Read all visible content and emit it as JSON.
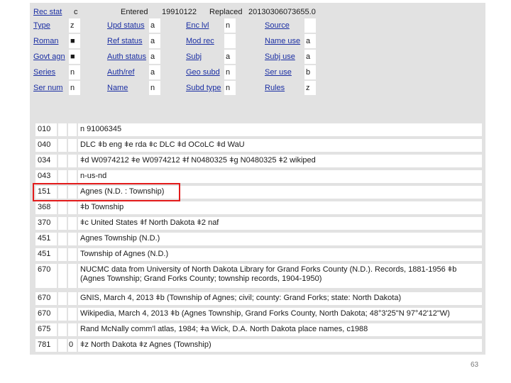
{
  "header": {
    "rec_stat_label": "Rec stat",
    "rec_stat_value": "c",
    "entered_label": "Entered",
    "entered_value": "19910122",
    "replaced_label": "Replaced",
    "replaced_value": "20130306073655.0"
  },
  "fixed_fields": [
    [
      {
        "label": "Type",
        "value": "z"
      },
      {
        "label": "Upd status",
        "value": "a"
      },
      {
        "label": "Enc lvl",
        "value": "n"
      },
      {
        "label": "Source",
        "value": ""
      }
    ],
    [
      {
        "label": "Roman",
        "value": "■"
      },
      {
        "label": "Ref status",
        "value": "a"
      },
      {
        "label": "Mod rec",
        "value": ""
      },
      {
        "label": "Name use",
        "value": "a"
      }
    ],
    [
      {
        "label": "Govt agn",
        "value": "■"
      },
      {
        "label": "Auth status",
        "value": "a"
      },
      {
        "label": "Subj",
        "value": "a"
      },
      {
        "label": "Subj use",
        "value": "a"
      }
    ],
    [
      {
        "label": "Series",
        "value": "n"
      },
      {
        "label": "Auth/ref",
        "value": "a"
      },
      {
        "label": "Geo subd",
        "value": "n"
      },
      {
        "label": "Ser use",
        "value": "b"
      }
    ],
    [
      {
        "label": "Ser num",
        "value": "n"
      },
      {
        "label": "Name",
        "value": "n"
      },
      {
        "label": "Subd type",
        "value": "n"
      },
      {
        "label": "Rules",
        "value": "z"
      }
    ]
  ],
  "fields": [
    {
      "tag": "010",
      "ind2": "",
      "value": "n 91006345"
    },
    {
      "tag": "040",
      "ind2": "",
      "value": "DLC ǂb eng ǂe rda ǂc DLC ǂd OCoLC ǂd WaU"
    },
    {
      "tag": "034",
      "ind2": "",
      "value": "ǂd W0974212 ǂe W0974212 ǂf N0480325 ǂg N0480325 ǂ2 wikiped"
    },
    {
      "tag": "043",
      "ind2": "",
      "value": "n-us-nd"
    },
    {
      "tag": "151",
      "ind2": "",
      "value": "Agnes (N.D. : Township)"
    },
    {
      "tag": "368",
      "ind2": "",
      "value": "ǂb Township"
    },
    {
      "tag": "370",
      "ind2": "",
      "value": "ǂc United States ǂf North Dakota ǂ2 naf"
    },
    {
      "tag": "451",
      "ind2": "",
      "value": "Agnes Township (N.D.)"
    },
    {
      "tag": "451",
      "ind2": "",
      "value": "Township of Agnes (N.D.)"
    },
    {
      "tag": "670",
      "ind2": "",
      "value": "NUCMC data from University of North Dakota Library for Grand Forks County (N.D.). Records, 1881-1956 ǂb (Agnes Township; Grand Forks County; township records, 1904-1950)"
    },
    {
      "tag": "670",
      "ind2": "",
      "value": "GNIS, March 4, 2013 ǂb (Township of Agnes; civil; county: Grand Forks; state: North Dakota)"
    },
    {
      "tag": "670",
      "ind2": "",
      "value": "Wikipedia, March 4, 2013 ǂb (Agnes Township, Grand Forks County, North Dakota; 48°3'25\"N 97°42'12\"W)"
    },
    {
      "tag": "675",
      "ind2": "",
      "value": "Rand McNally comm'l atlas, 1984; ǂa Wick, D.A. North Dakota place names, c1988"
    },
    {
      "tag": "781",
      "ind2": "0",
      "value": "ǂz North Dakota ǂz Agnes (Township)"
    }
  ],
  "page_number": "63",
  "colors": {
    "highlight": "#e31b1b",
    "link": "#1b2fa3",
    "panel": "#e2e2e2"
  }
}
